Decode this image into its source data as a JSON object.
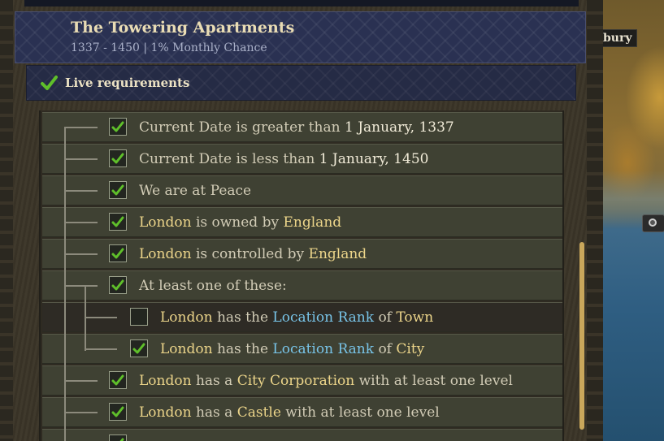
{
  "map": {
    "label": "bury"
  },
  "header": {
    "title": "The Towering Apartments",
    "subtitle": "1337 - 1450 | 1% Monthly Chance"
  },
  "requirements": {
    "label": "Live requirements"
  },
  "rows": [
    {
      "checked": true,
      "indent": 0,
      "parts": [
        {
          "t": "Current Date is greater than ",
          "c": "plain"
        },
        {
          "t": "1 January, 1337",
          "c": "val"
        }
      ]
    },
    {
      "checked": true,
      "indent": 0,
      "parts": [
        {
          "t": "Current Date is less than ",
          "c": "plain"
        },
        {
          "t": "1 January, 1450",
          "c": "val"
        }
      ]
    },
    {
      "checked": true,
      "indent": 0,
      "parts": [
        {
          "t": "We are at Peace",
          "c": "plain"
        }
      ]
    },
    {
      "checked": true,
      "indent": 0,
      "parts": [
        {
          "t": "London",
          "c": "hi"
        },
        {
          "t": " is owned by ",
          "c": "plain"
        },
        {
          "t": "England",
          "c": "hi"
        }
      ]
    },
    {
      "checked": true,
      "indent": 0,
      "parts": [
        {
          "t": "London",
          "c": "hi"
        },
        {
          "t": " is controlled by ",
          "c": "plain"
        },
        {
          "t": "England",
          "c": "hi"
        }
      ]
    },
    {
      "checked": true,
      "indent": 0,
      "parts": [
        {
          "t": "At least one of these:",
          "c": "plain"
        }
      ]
    },
    {
      "checked": false,
      "indent": 1,
      "dark": true,
      "parts": [
        {
          "t": "London",
          "c": "hi"
        },
        {
          "t": " has the ",
          "c": "plain"
        },
        {
          "t": "Location Rank",
          "c": "link"
        },
        {
          "t": " of ",
          "c": "plain"
        },
        {
          "t": "Town",
          "c": "hi"
        }
      ]
    },
    {
      "checked": true,
      "indent": 1,
      "parts": [
        {
          "t": "London",
          "c": "hi"
        },
        {
          "t": " has the ",
          "c": "plain"
        },
        {
          "t": "Location Rank",
          "c": "link"
        },
        {
          "t": " of ",
          "c": "plain"
        },
        {
          "t": "City",
          "c": "hi"
        }
      ]
    },
    {
      "checked": true,
      "indent": 0,
      "parts": [
        {
          "t": "London",
          "c": "hi"
        },
        {
          "t": " has a ",
          "c": "plain"
        },
        {
          "t": "City Corporation",
          "c": "hi"
        },
        {
          "t": " with at least one level",
          "c": "plain"
        }
      ]
    },
    {
      "checked": true,
      "indent": 0,
      "parts": [
        {
          "t": "London",
          "c": "hi"
        },
        {
          "t": " has a ",
          "c": "plain"
        },
        {
          "t": "Castle",
          "c": "hi"
        },
        {
          "t": " with at least one level",
          "c": "plain"
        }
      ]
    },
    {
      "checked": true,
      "indent": 0,
      "parts": []
    }
  ],
  "colors": {
    "check_green": "#5fbf2a",
    "highlight": "#ecd58a",
    "link": "#78c4e8"
  },
  "icons": {
    "check": "check-icon",
    "map_marker": "map-marker-icon"
  }
}
